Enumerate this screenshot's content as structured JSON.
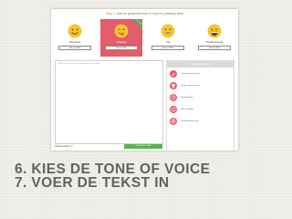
{
  "screenshot": {
    "step_label": "Stap 3:",
    "step_text": "Kies de gewenste tone of voice en plaats je tekst",
    "tones": [
      {
        "name": "Informeel",
        "emoji": "smile",
        "button": "SELECTEER",
        "selected": false
      },
      {
        "name": "Grappig",
        "emoji": "wink-tongue",
        "button": "SELECTEER",
        "selected": true,
        "badge": "ACTIEF"
      },
      {
        "name": "Vrij",
        "emoji": "grin",
        "button": "SELECTEER",
        "selected": false
      },
      {
        "name": "Professioneel",
        "emoji": "laugh",
        "button": "SELECTEER",
        "selected": false
      }
    ],
    "editor_placeholder": "Plaats hier je tekst voor tekst-plaatsen hieronder",
    "word_count": "Aantal woorden: 0",
    "submit_label": "VOLGENDE STAP",
    "panel": {
      "title": "Voor jouw schrijver",
      "items": [
        {
          "icon": "pencil-icon",
          "text": "Professionele schrijvers"
        },
        {
          "icon": "bulb-icon",
          "text": "Unieke content garantie"
        },
        {
          "icon": "clock-icon",
          "text": "Snelle levering"
        },
        {
          "icon": "monitor-icon",
          "text": "SEO-vriendelijk"
        },
        {
          "icon": "globe-icon",
          "text": "Tevredenheidsgarantie"
        }
      ]
    },
    "colors": {
      "accent": "#e35d6a",
      "green": "#5ab24a",
      "orange": "#e8833a"
    }
  },
  "caption": {
    "line1": "6. KIES DE TONE OF VOICE",
    "line2": "7. VOER DE TEKST IN"
  }
}
